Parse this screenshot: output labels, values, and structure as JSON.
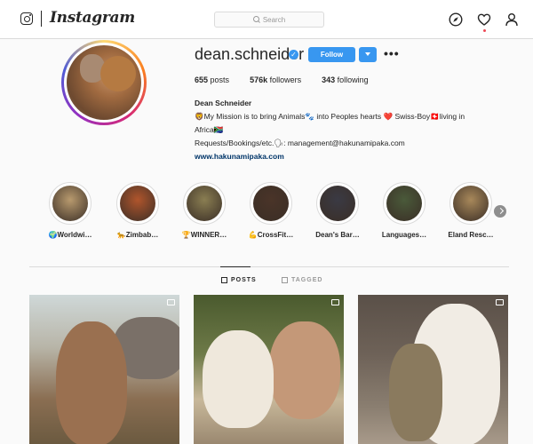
{
  "app": {
    "wordmark": "Instagram"
  },
  "search": {
    "placeholder": "Search"
  },
  "profile": {
    "username": "dean.schneider",
    "follow_label": "Follow",
    "more_label": "•••",
    "stats": [
      {
        "value": "655",
        "label": "posts"
      },
      {
        "value": "576k",
        "label": "followers"
      },
      {
        "value": "343",
        "label": "following"
      }
    ],
    "bio": {
      "name": "Dean Schneider",
      "line1": "🦁My Mission is to bring Animals🐾 into Peoples hearts ❤️ Swiss-Boy🇨🇭living in",
      "line2": "Africa🇿🇦",
      "line3": "Requests/Bookings/etc.🗣: management@hakunamipaka.com",
      "link": "www.hakunamipaka.com"
    }
  },
  "highlights": [
    {
      "label": "🌍Worldwi…",
      "color": "#b89a6e"
    },
    {
      "label": "🐆Zimbab…",
      "color": "#b0552c"
    },
    {
      "label": "🏆WINNER…",
      "color": "#8a7e52"
    },
    {
      "label": "💪CrossFit…",
      "color": "#4a3428"
    },
    {
      "label": "Dean's Bar…",
      "color": "#3a3a44"
    },
    {
      "label": "Languages…",
      "color": "#4a5a3a"
    },
    {
      "label": "Eland Resc…",
      "color": "#a8885a"
    }
  ],
  "tabs": {
    "posts": "POSTS",
    "tagged": "TAGGED"
  },
  "colors": {
    "accent": "#3897f0",
    "link": "#003569"
  }
}
